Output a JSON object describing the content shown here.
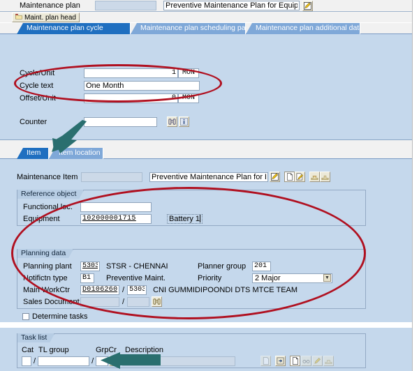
{
  "header": {
    "label": "Maintenance plan",
    "plan_number": "",
    "plan_description": "Preventive Maintenance Plan for Equipmen",
    "edit_icon": "pencil-edit-icon",
    "head_button": "Maint. plan head",
    "head_button_icon": "folder-icon"
  },
  "tabs": [
    {
      "label": "Maintenance plan cycle",
      "selected": true
    },
    {
      "label": "Maintenance plan scheduling parameters",
      "selected": false
    },
    {
      "label": "Maintenance plan additional data",
      "selected": false
    }
  ],
  "cycle_section": {
    "rows": [
      {
        "label": "Cycle/Unit",
        "value": "1",
        "unit": "MON"
      },
      {
        "label": "Cycle text",
        "value": "One Month",
        "unit": ""
      },
      {
        "label": "Offset/Unit",
        "value": "0",
        "unit": "MON"
      }
    ],
    "counter": {
      "label": "Counter",
      "value": "",
      "search_icon": "binoculars-search-icon",
      "info_icon": "info-icon"
    }
  },
  "item_tabs": [
    {
      "label": "Item",
      "selected": true
    },
    {
      "label": "Item location",
      "selected": false
    }
  ],
  "item_section": {
    "label": "Maintenance Item",
    "number": "",
    "description": "Preventive Maintenance Plan for Equip",
    "toolbar": [
      {
        "name": "pencil-edit-icon"
      },
      {
        "name": "new-document-icon"
      },
      {
        "name": "document-with-pen-icon"
      },
      {
        "name": "stamp-icon"
      },
      {
        "name": "stamp-alt-icon"
      }
    ]
  },
  "reference_object": {
    "title": "Reference object",
    "functional_loc": {
      "label": "Functional loc.",
      "value": ""
    },
    "equipment": {
      "label": "Equipment",
      "value": "102000001715",
      "description": "Battery 1"
    }
  },
  "planning_data": {
    "title": "Planning data",
    "planning_plant": {
      "label": "Planning plant",
      "value": "5303",
      "description": "STSR - CHENNAI"
    },
    "planner_group": {
      "label": "Planner group",
      "value": "201"
    },
    "notification_type": {
      "label": "Notifictn type",
      "value": "B1",
      "description": "Preventive Maint."
    },
    "priority": {
      "label": "Priority",
      "value": "2 Major",
      "dropdown_icon": "chevron-down-icon"
    },
    "main_workctr": {
      "label": "Main WorkCtr",
      "value": "D0106260",
      "plant": "5303",
      "description": "CNI GUMMIDIPOONDI DTS MTCE TEAM"
    },
    "sales_document": {
      "label": "Sales Document",
      "value": "",
      "item": "",
      "search_icon": "binoculars-search-icon"
    },
    "determine_tasks": {
      "label": "Determine tasks",
      "checked": false
    }
  },
  "task_list": {
    "title": "Task list",
    "columns": [
      "Cat",
      "TL group",
      "GrpCr",
      "Description"
    ],
    "row": {
      "cat": "",
      "tl_group": "",
      "grp_cr": "",
      "description": ""
    },
    "search_icon": "binoculars-search-icon",
    "toolbar": [
      {
        "name": "document-dim-icon"
      },
      {
        "name": "document-arrow-icon"
      },
      {
        "name": "new-page-icon"
      },
      {
        "name": "glasses-icon"
      },
      {
        "name": "pencil-icon"
      },
      {
        "name": "stamp-icon"
      }
    ]
  },
  "annotations": {
    "highlight_color": "#b01020",
    "arrow_color": "#2a6f6f",
    "ellipses": [
      "cycle-fields-highlight",
      "reference-planning-highlight"
    ],
    "arrows": [
      "arrow-to-item-tab",
      "arrow-to-task-list-search"
    ]
  }
}
